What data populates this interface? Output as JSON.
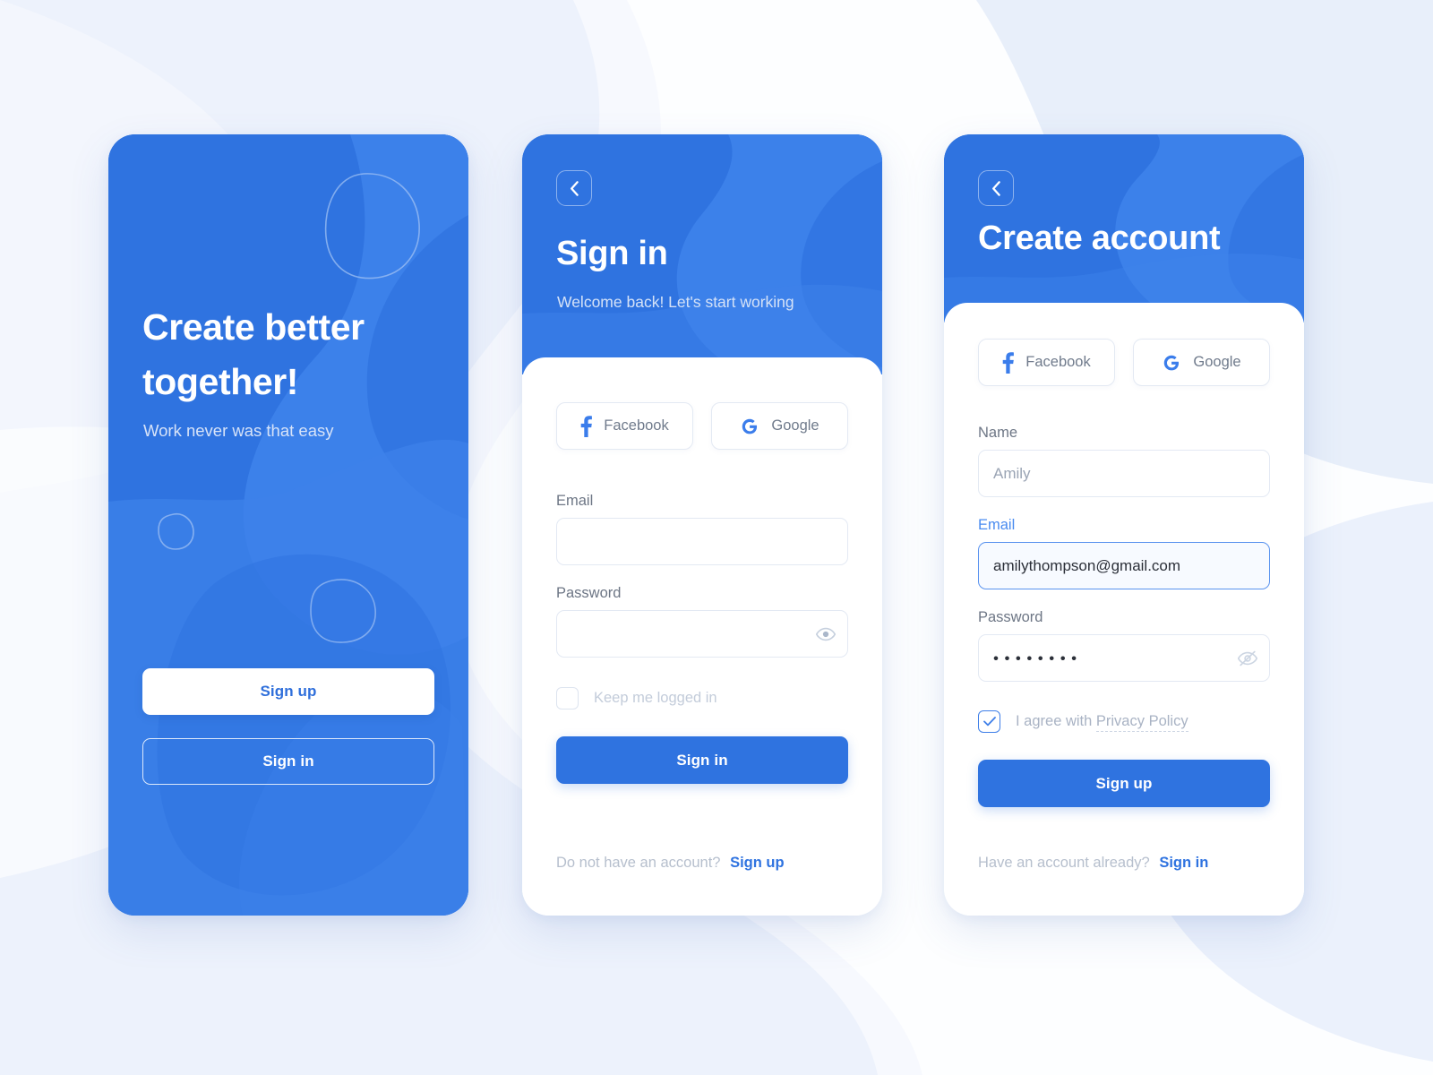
{
  "theme": {
    "accent": "#2f73e0",
    "accent_light": "#3f82ea",
    "page_bg": "#edf2fc",
    "card_bg": "#ffffff",
    "muted_text": "#b6bfcd",
    "label_text": "#6d7685",
    "focus_blue": "#5a93ef"
  },
  "screens": {
    "onboarding": {
      "title": "Create better together!",
      "subtitle": "Work never was that easy",
      "primary_button": "Sign up",
      "secondary_button": "Sign in"
    },
    "signin": {
      "back_icon": "chevron-left-icon",
      "title": "Sign in",
      "subtitle": "Welcome back! Let's start working",
      "social": [
        {
          "icon": "facebook-icon",
          "label": "Facebook"
        },
        {
          "icon": "google-icon",
          "label": "Google"
        }
      ],
      "email": {
        "label": "Email",
        "value": "",
        "placeholder": ""
      },
      "password": {
        "label": "Password",
        "value": "",
        "placeholder": "",
        "toggle_icon": "eye-icon"
      },
      "keep_logged_in": {
        "label": "Keep me logged in",
        "checked": false
      },
      "submit_button": "Sign in",
      "footer": {
        "text": "Do not have an account?",
        "link": "Sign up"
      }
    },
    "signup": {
      "back_icon": "chevron-left-icon",
      "title": "Create account",
      "social": [
        {
          "icon": "facebook-icon",
          "label": "Facebook"
        },
        {
          "icon": "google-icon",
          "label": "Google"
        }
      ],
      "name": {
        "label": "Name",
        "value": "",
        "placeholder": "Amily"
      },
      "email": {
        "label": "Email",
        "value": "amilythompson@gmail.com",
        "placeholder": "",
        "focused": true
      },
      "password": {
        "label": "Password",
        "value": "••••••••",
        "masked_char_count": 8,
        "toggle_icon": "eye-off-icon"
      },
      "agree": {
        "prefix": "I agree with",
        "link": "Privacy Policy",
        "checked": true
      },
      "submit_button": "Sign up",
      "footer": {
        "text": "Have an account already?",
        "link": "Sign in"
      }
    }
  }
}
